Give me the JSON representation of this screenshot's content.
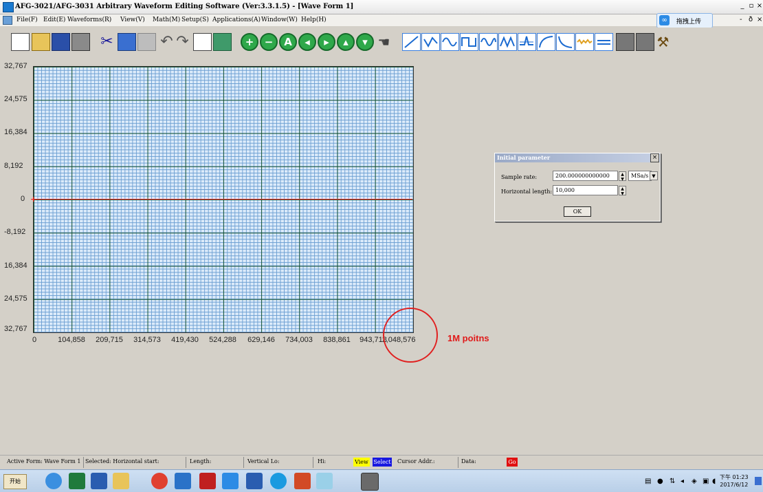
{
  "window": {
    "title": "AFG-3021/AFG-3031 Arbitrary Waveform Editing Software (Ver:3.3.1.5) - [Wave Form 1]",
    "minimize": "_",
    "restore": "▫",
    "close": "×",
    "mdi_restore": "-",
    "mdi_sizer": "ð",
    "mdi_close": "×"
  },
  "menu": {
    "items": [
      "File(F)",
      "Edit(E)",
      "Waveforms(R)",
      "View(V)",
      "Math(M)",
      "Setup(S)",
      "Applications(A)",
      "Window(W)",
      "Help(H)"
    ],
    "cloud_upload_label": "拖拽上传"
  },
  "plot": {
    "y_ticks": [
      "32,767",
      "24,575",
      "16,384",
      "8,192",
      "0",
      "-8,192",
      "16,384",
      "24,575",
      "32,767"
    ],
    "x_ticks": [
      "0",
      "104,858",
      "209,715",
      "314,573",
      "419,430",
      "524,288",
      "629,146",
      "734,003",
      "838,861",
      "943,718",
      "1,048,576"
    ],
    "annotation": "1M poitns",
    "zero_marker": "+"
  },
  "dialog": {
    "title": "Initial parameter",
    "close": "×",
    "sample_rate_label": "Sample rate:",
    "sample_rate_value": "200.000000000000",
    "sample_rate_unit": "MSa/s",
    "horizontal_length_label": "Horizontal length:",
    "horizontal_length_value": "10,000",
    "ok_label": "OK"
  },
  "statusbar": {
    "active_form": "Active Form: Wave Form 1",
    "selected": "Selected: Horizontal start:",
    "length": "Length:",
    "vertical_lo": "Vertical Lo:",
    "hi": "Hi:",
    "view": "View",
    "select": "Select",
    "cursor_addr": "Cursor Addr.:",
    "data": "Data:",
    "go": "Go"
  },
  "taskbar": {
    "start_label": "开始",
    "clock_time": "下午 01:23",
    "clock_date": "2017/6/12"
  },
  "colors": {
    "grid_major": "#145028",
    "grid_minor": "#6c9fd2",
    "plot_bg": "#dcebfa",
    "zero_line": "#ff2020",
    "annotation": "#e01a1a"
  }
}
